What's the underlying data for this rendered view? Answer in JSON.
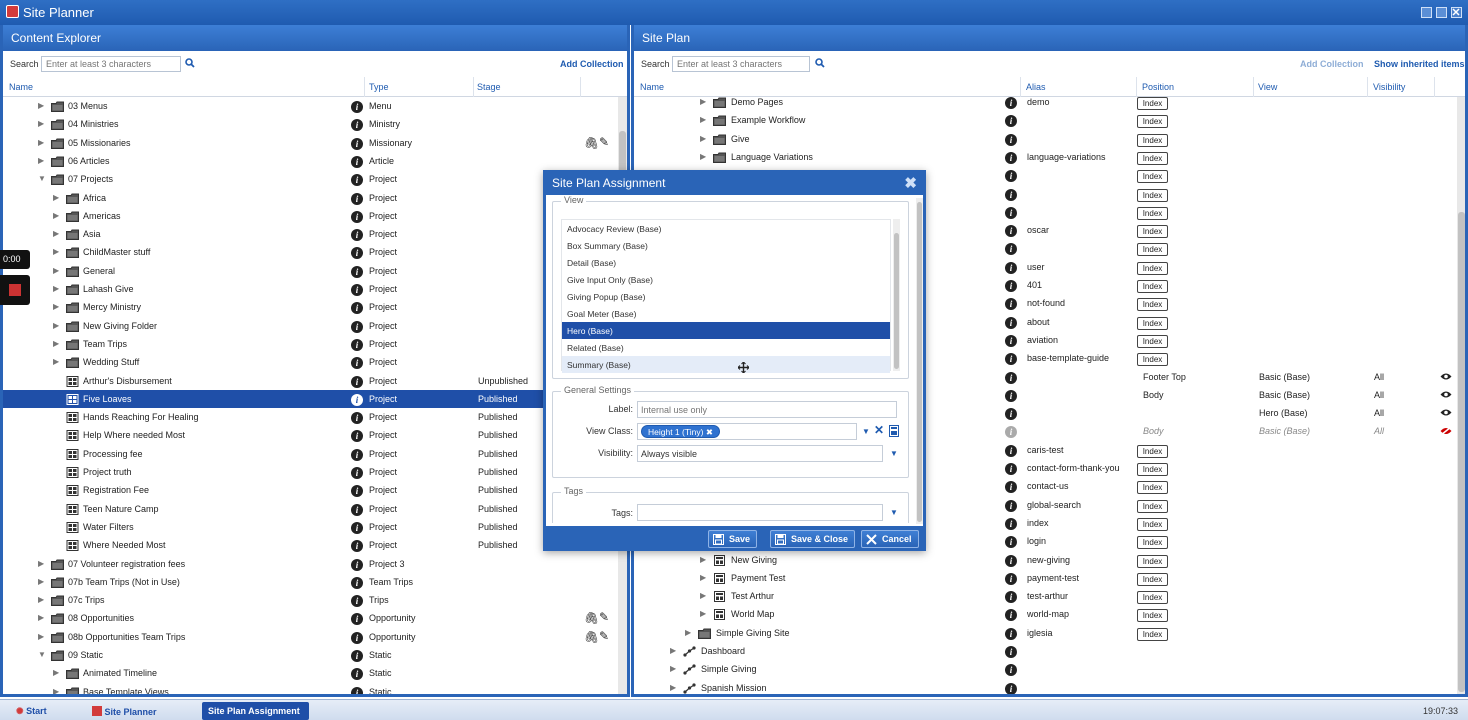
{
  "app": {
    "title": "Site Planner"
  },
  "left": {
    "title": "Content Explorer",
    "search_label": "Search",
    "search_placeholder": "Enter at least 3 characters",
    "add_collection": "Add Collection",
    "cols": {
      "name": "Name",
      "type": "Type",
      "stage": "Stage"
    },
    "rows": [
      {
        "indent": 0,
        "toggle": "▶",
        "icon": "folder",
        "name": "03 Menus",
        "type": "Menu",
        "stage": ""
      },
      {
        "indent": 0,
        "toggle": "▶",
        "icon": "folder",
        "name": "04 Ministries",
        "type": "Ministry",
        "stage": ""
      },
      {
        "indent": 0,
        "toggle": "▶",
        "icon": "folder",
        "name": "05 Missionaries",
        "type": "Missionary",
        "stage": "",
        "actions": true
      },
      {
        "indent": 0,
        "toggle": "▶",
        "icon": "folder",
        "name": "06 Articles",
        "type": "Article",
        "stage": ""
      },
      {
        "indent": 0,
        "toggle": "▼",
        "icon": "folder",
        "name": "07 Projects",
        "type": "Project",
        "stage": ""
      },
      {
        "indent": 1,
        "toggle": "▶",
        "icon": "folder",
        "name": "Africa",
        "type": "Project",
        "stage": ""
      },
      {
        "indent": 1,
        "toggle": "▶",
        "icon": "folder",
        "name": "Americas",
        "type": "Project",
        "stage": ""
      },
      {
        "indent": 1,
        "toggle": "▶",
        "icon": "folder",
        "name": "Asia",
        "type": "Project",
        "stage": ""
      },
      {
        "indent": 1,
        "toggle": "▶",
        "icon": "folder",
        "name": "ChildMaster stuff",
        "type": "Project",
        "stage": ""
      },
      {
        "indent": 1,
        "toggle": "▶",
        "icon": "folder",
        "name": "General",
        "type": "Project",
        "stage": ""
      },
      {
        "indent": 1,
        "toggle": "▶",
        "icon": "folder",
        "name": "Lahash Give",
        "type": "Project",
        "stage": ""
      },
      {
        "indent": 1,
        "toggle": "▶",
        "icon": "folder",
        "name": "Mercy Ministry",
        "type": "Project",
        "stage": ""
      },
      {
        "indent": 1,
        "toggle": "▶",
        "icon": "folder",
        "name": "New Giving Folder",
        "type": "Project",
        "stage": ""
      },
      {
        "indent": 1,
        "toggle": "▶",
        "icon": "folder",
        "name": "Team Trips",
        "type": "Project",
        "stage": ""
      },
      {
        "indent": 1,
        "toggle": "▶",
        "icon": "folder",
        "name": "Wedding Stuff",
        "type": "Project",
        "stage": ""
      },
      {
        "indent": 1,
        "toggle": "",
        "icon": "item",
        "name": "Arthur's Disbursement",
        "type": "Project",
        "stage": "Unpublished"
      },
      {
        "indent": 1,
        "toggle": "",
        "icon": "item",
        "name": "Five Loaves",
        "type": "Project",
        "stage": "Published",
        "selected": true
      },
      {
        "indent": 1,
        "toggle": "",
        "icon": "item",
        "name": "Hands Reaching For Healing",
        "type": "Project",
        "stage": "Published"
      },
      {
        "indent": 1,
        "toggle": "",
        "icon": "item",
        "name": "Help Where needed Most",
        "type": "Project",
        "stage": "Published"
      },
      {
        "indent": 1,
        "toggle": "",
        "icon": "item",
        "name": "Processing fee",
        "type": "Project",
        "stage": "Published"
      },
      {
        "indent": 1,
        "toggle": "",
        "icon": "item",
        "name": "Project truth",
        "type": "Project",
        "stage": "Published"
      },
      {
        "indent": 1,
        "toggle": "",
        "icon": "item",
        "name": "Registration Fee",
        "type": "Project",
        "stage": "Published"
      },
      {
        "indent": 1,
        "toggle": "",
        "icon": "item",
        "name": "Teen Nature Camp",
        "type": "Project",
        "stage": "Published"
      },
      {
        "indent": 1,
        "toggle": "",
        "icon": "item",
        "name": "Water Filters",
        "type": "Project",
        "stage": "Published"
      },
      {
        "indent": 1,
        "toggle": "",
        "icon": "item",
        "name": "Where Needed Most",
        "type": "Project",
        "stage": "Published"
      },
      {
        "indent": 0,
        "toggle": "▶",
        "icon": "folder",
        "name": "07 Volunteer registration fees",
        "type": "Project 3",
        "stage": ""
      },
      {
        "indent": 0,
        "toggle": "▶",
        "icon": "folder",
        "name": "07b Team Trips (Not in Use)",
        "type": "Team Trips",
        "stage": ""
      },
      {
        "indent": 0,
        "toggle": "▶",
        "icon": "folder",
        "name": "07c Trips",
        "type": "Trips",
        "stage": ""
      },
      {
        "indent": 0,
        "toggle": "▶",
        "icon": "folder",
        "name": "08 Opportunities",
        "type": "Opportunity",
        "stage": "",
        "actions": true
      },
      {
        "indent": 0,
        "toggle": "▶",
        "icon": "folder",
        "name": "08b Opportunities Team Trips",
        "type": "Opportunity",
        "stage": "",
        "actions": true
      },
      {
        "indent": 0,
        "toggle": "▼",
        "icon": "folder",
        "name": "09 Static",
        "type": "Static",
        "stage": ""
      },
      {
        "indent": 1,
        "toggle": "▶",
        "icon": "folder",
        "name": "Animated Timeline",
        "type": "Static",
        "stage": ""
      },
      {
        "indent": 1,
        "toggle": "▶",
        "icon": "folder",
        "name": "Base Template Views",
        "type": "Static",
        "stage": ""
      }
    ]
  },
  "right": {
    "title": "Site Plan",
    "search_label": "Search",
    "search_placeholder": "Enter at least 3 characters",
    "add_collection": "Add Collection",
    "show_inherited": "Show inherited items",
    "cols": {
      "name": "Name",
      "alias": "Alias",
      "position": "Position",
      "view": "View",
      "visibility": "Visibility"
    },
    "rows": [
      {
        "indent": 2,
        "toggle": "▶",
        "icon": "folder",
        "name": "Demo Pages",
        "alias": "demo",
        "index": true
      },
      {
        "indent": 2,
        "toggle": "▶",
        "icon": "folder",
        "name": "Example Workflow",
        "alias": "",
        "index": true
      },
      {
        "indent": 2,
        "toggle": "▶",
        "icon": "folder",
        "name": "Give",
        "alias": "",
        "index": true
      },
      {
        "indent": 2,
        "toggle": "▶",
        "icon": "folder",
        "name": "Language Variations",
        "alias": "language-variations",
        "index": true
      },
      {
        "indent": 2,
        "toggle": "",
        "icon": "",
        "name": "",
        "alias": "",
        "index": true
      },
      {
        "indent": 2,
        "toggle": "",
        "icon": "",
        "name": "",
        "alias": "",
        "index": true
      },
      {
        "indent": 2,
        "toggle": "",
        "icon": "",
        "name": "",
        "alias": "",
        "index": true
      },
      {
        "indent": 2,
        "toggle": "",
        "icon": "",
        "name": "",
        "alias": "oscar",
        "index": true
      },
      {
        "indent": 2,
        "toggle": "",
        "icon": "",
        "name": "",
        "alias": "",
        "index": true
      },
      {
        "indent": 2,
        "toggle": "",
        "icon": "",
        "name": "",
        "alias": "user",
        "index": true
      },
      {
        "indent": 2,
        "toggle": "",
        "icon": "",
        "name": "",
        "alias": "401",
        "index": true
      },
      {
        "indent": 2,
        "toggle": "",
        "icon": "",
        "name": "",
        "alias": "not-found",
        "index": true
      },
      {
        "indent": 2,
        "toggle": "",
        "icon": "",
        "name": "",
        "alias": "about",
        "index": true
      },
      {
        "indent": 2,
        "toggle": "",
        "icon": "",
        "name": "",
        "alias": "aviation",
        "index": true
      },
      {
        "indent": 2,
        "toggle": "",
        "icon": "",
        "name": "",
        "alias": "base-template-guide",
        "index": true
      },
      {
        "indent": 2,
        "toggle": "",
        "icon": "",
        "name": "",
        "alias": "",
        "position": "Footer Top",
        "view": "Basic (Base)",
        "visibility": "All",
        "eye": "on"
      },
      {
        "indent": 2,
        "toggle": "",
        "icon": "",
        "name": "",
        "alias": "",
        "position": "Body",
        "view": "Basic (Base)",
        "visibility": "All",
        "eye": "on"
      },
      {
        "indent": 2,
        "toggle": "",
        "icon": "",
        "name": "",
        "alias": "",
        "position": "",
        "view": "Hero (Base)",
        "visibility": "All",
        "eye": "on"
      },
      {
        "indent": 2,
        "toggle": "",
        "icon": "",
        "name": "",
        "alias": "",
        "position": "Body",
        "view": "Basic (Base)",
        "visibility": "All",
        "eye": "off",
        "inherited": true
      },
      {
        "indent": 2,
        "toggle": "",
        "icon": "",
        "name": "",
        "alias": "caris-test",
        "index": true
      },
      {
        "indent": 2,
        "toggle": "",
        "icon": "",
        "name": "",
        "alias": "contact-form-thank-you",
        "index": true
      },
      {
        "indent": 2,
        "toggle": "",
        "icon": "",
        "name": "",
        "alias": "contact-us",
        "index": true
      },
      {
        "indent": 2,
        "toggle": "",
        "icon": "",
        "name": "",
        "alias": "global-search",
        "index": true
      },
      {
        "indent": 2,
        "toggle": "",
        "icon": "",
        "name": "",
        "alias": "index",
        "index": true
      },
      {
        "indent": 2,
        "toggle": "",
        "icon": "",
        "name": "",
        "alias": "login",
        "index": true
      },
      {
        "indent": 2,
        "toggle": "▶",
        "icon": "page",
        "name": "New Giving",
        "alias": "new-giving",
        "index": true
      },
      {
        "indent": 2,
        "toggle": "▶",
        "icon": "page",
        "name": "Payment Test",
        "alias": "payment-test",
        "index": true
      },
      {
        "indent": 2,
        "toggle": "▶",
        "icon": "page",
        "name": "Test Arthur",
        "alias": "test-arthur",
        "index": true
      },
      {
        "indent": 2,
        "toggle": "▶",
        "icon": "page",
        "name": "World Map",
        "alias": "world-map",
        "index": true
      },
      {
        "indent": 1,
        "toggle": "▶",
        "icon": "folder",
        "name": "Simple Giving Site",
        "alias": "iglesia",
        "index": true
      },
      {
        "indent": 0,
        "toggle": "▶",
        "icon": "site",
        "name": "Dashboard",
        "alias": ""
      },
      {
        "indent": 0,
        "toggle": "▶",
        "icon": "site",
        "name": "Simple Giving",
        "alias": ""
      },
      {
        "indent": 0,
        "toggle": "▶",
        "icon": "site",
        "name": "Spanish Mission",
        "alias": ""
      }
    ],
    "index_label": "Index"
  },
  "dialog": {
    "title": "Site Plan Assignment",
    "view_legend": "View",
    "views": [
      "Advocacy Review (Base)",
      "Box Summary (Base)",
      "Detail (Base)",
      "Give Input Only (Base)",
      "Giving Popup (Base)",
      "Goal Meter (Base)",
      "Hero (Base)",
      "Related (Base)",
      "Summary (Base)"
    ],
    "selected_view": 6,
    "hover_view": 8,
    "general_legend": "General Settings",
    "label_label": "Label:",
    "label_placeholder": "Internal use only",
    "viewclass_label": "View Class:",
    "viewclass_chip": "Height 1 (Tiny)",
    "visibility_label": "Visibility:",
    "visibility_value": "Always visible",
    "tags_legend": "Tags",
    "tags_label": "Tags:",
    "save": "Save",
    "save_close": "Save & Close",
    "cancel": "Cancel"
  },
  "overlay": {
    "timer": "0:00"
  },
  "taskbar": {
    "start": "Start",
    "item1": "Site Planner",
    "item2": "Site Plan Assignment",
    "clock": "19:07:33"
  }
}
